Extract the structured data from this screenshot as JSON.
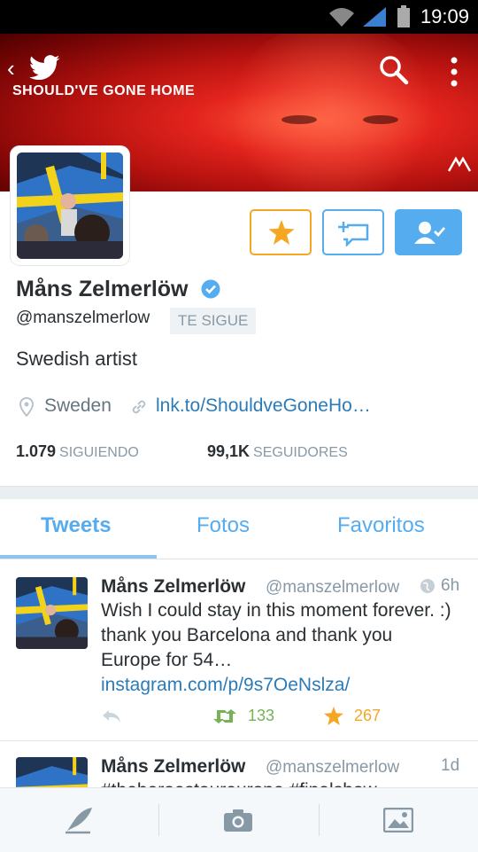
{
  "status_bar": {
    "time": "19:09"
  },
  "banner": {
    "song_title": "SHOULD'VE GONE HOME"
  },
  "profile": {
    "name": "Måns Zelmerlöw",
    "handle": "@manszelmerlow",
    "follows_you": "TE SIGUE",
    "bio": "Swedish artist",
    "location": "Sweden",
    "website": "lnk.to/ShouldveGoneHo…",
    "following_count": "1.079",
    "following_label": "SIGUIENDO",
    "followers_count": "99,1K",
    "followers_label": "SEGUIDORES"
  },
  "tabs": [
    "Tweets",
    "Fotos",
    "Favoritos"
  ],
  "tweets": [
    {
      "name": "Måns Zelmerlöw",
      "handle": "@manszelmerlow",
      "time": "6h",
      "text": "Wish I could stay in this moment forever. :) thank you Barcelona and thank you Europe for 54…",
      "link": "instagram.com/p/9s7OeNslza/",
      "retweets": "133",
      "favorites": "267"
    },
    {
      "name": "Måns Zelmerlöw",
      "handle": "@manszelmerlow",
      "time": "1d",
      "text": "#theheroestoureurope #finalshow"
    }
  ],
  "colors": {
    "accent": "#55acee",
    "favorite": "#f5a623",
    "retweet": "#77b255",
    "link": "#2b7bb9",
    "muted": "#8899a6"
  }
}
